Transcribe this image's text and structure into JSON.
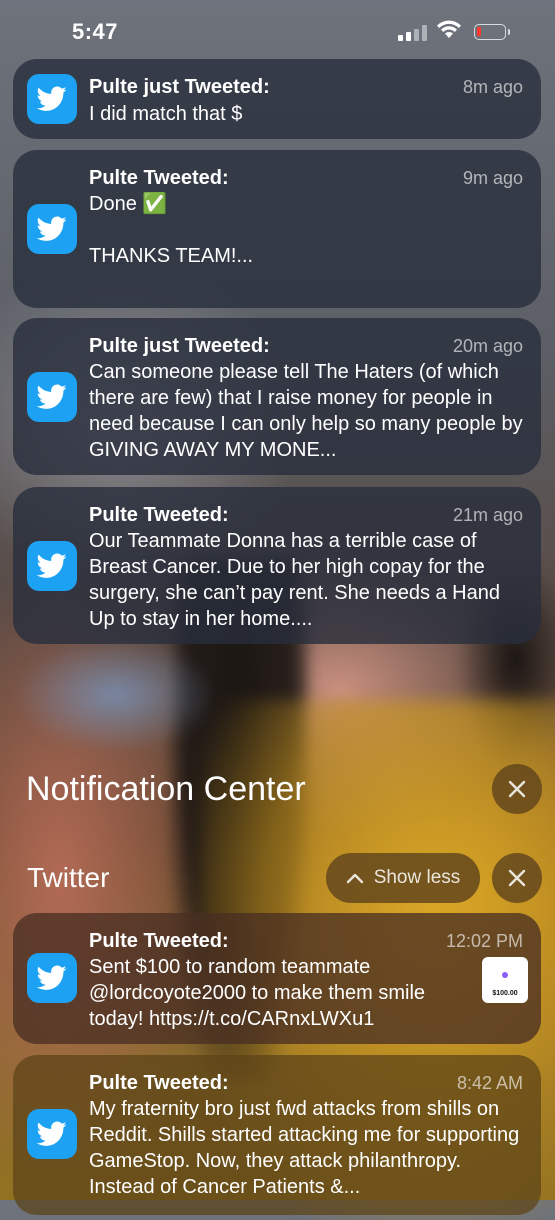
{
  "status_bar": {
    "time": "5:47"
  },
  "notifications_top": [
    {
      "app": "Twitter",
      "title": "Pulte just Tweeted:",
      "time_ago": "8m ago",
      "body": "I did match that $"
    },
    {
      "app": "Twitter",
      "title": "Pulte Tweeted:",
      "time_ago": "9m ago",
      "body": "Done ✅\n\nTHANKS TEAM!..."
    },
    {
      "app": "Twitter",
      "title": "Pulte just Tweeted:",
      "time_ago": "20m ago",
      "body": "Can someone please tell The Haters (of which there are few) that I raise money for people in need because I can only help so many people by GIVING AWAY MY MONE..."
    },
    {
      "app": "Twitter",
      "title": "Pulte Tweeted:",
      "time_ago": "21m ago",
      "body": "Our Teammate Donna has a terrible case of Breast Cancer. Due to her high copay for the surgery, she can’t pay rent. She needs a Hand Up to stay in her home...."
    }
  ],
  "notification_center": {
    "title": "Notification Center"
  },
  "twitter_group": {
    "label": "Twitter",
    "show_less": "Show less",
    "notifications": [
      {
        "title": "Pulte Tweeted:",
        "time_ago": "12:02 PM",
        "body": "Sent $100 to random teammate @lordcoyote2000 to make them smile today! https://t.co/CARnxLWXu1",
        "thumbnail_amount": "$100.00"
      },
      {
        "title": "Pulte Tweeted:",
        "time_ago": "8:42 AM",
        "body": "My fraternity bro just fwd attacks from shills on Reddit. Shills started attacking me for supporting GameStop. Now, they attack philanthropy. Instead of Cancer Patients &..."
      }
    ]
  },
  "colors": {
    "twitter_blue": "#1da1f2",
    "battery_low": "#ff3b30"
  }
}
